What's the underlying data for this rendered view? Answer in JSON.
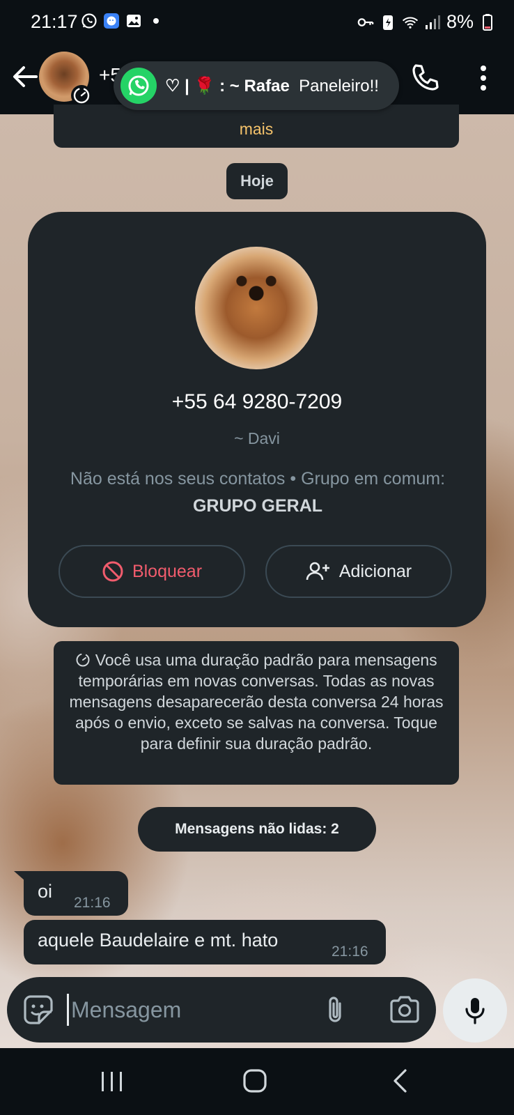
{
  "status_bar": {
    "time": "21:17",
    "battery": "8%",
    "icons": [
      "whatsapp-icon",
      "chat-bubble-icon",
      "image-icon",
      "dot-icon",
      "key-icon",
      "battery-saver-icon",
      "wifi-icon",
      "signal-icon",
      "battery-icon"
    ]
  },
  "header": {
    "title": "+5",
    "icons": [
      "back-arrow-icon",
      "timer-icon",
      "phone-icon",
      "more-vertical-icon"
    ]
  },
  "notification": {
    "sender": "♡ | 🌹 : ~ Rafae",
    "preview": "Paneleiro!!",
    "app_icon": "whatsapp-icon"
  },
  "top_card": {
    "link_text": "mais"
  },
  "date_chip": "Hoje",
  "contact_card": {
    "phone": "+55 64 9280-7209",
    "nickname": "~ Davi",
    "info_prefix": "Não está nos seus contatos • Grupo em comum: ",
    "group_name": "GRUPO GERAL",
    "block_label": "Bloquear",
    "add_label": "Adicionar"
  },
  "system_message": "Você usa uma duração padrão para mensagens temporárias em novas conversas. Todas as novas mensagens desaparecerão desta conversa 24 horas após o envio, exceto se salvas na conversa. Toque para definir sua duração padrão.",
  "unread_label": "Mensagens não lidas: 2",
  "messages": [
    {
      "text": "oi",
      "time": "21:16"
    },
    {
      "text": "aquele Baudelaire e mt. hato",
      "time": "21:16"
    }
  ],
  "composer": {
    "placeholder": "Mensagem",
    "icons": [
      "sticker-icon",
      "paperclip-icon",
      "camera-icon",
      "microphone-icon"
    ]
  },
  "colors": {
    "background": "#0b1014",
    "bubble": "#1f2529",
    "accent_green": "#25d366",
    "block_red": "#f15c6d",
    "link_yellow": "#f5c36b"
  }
}
